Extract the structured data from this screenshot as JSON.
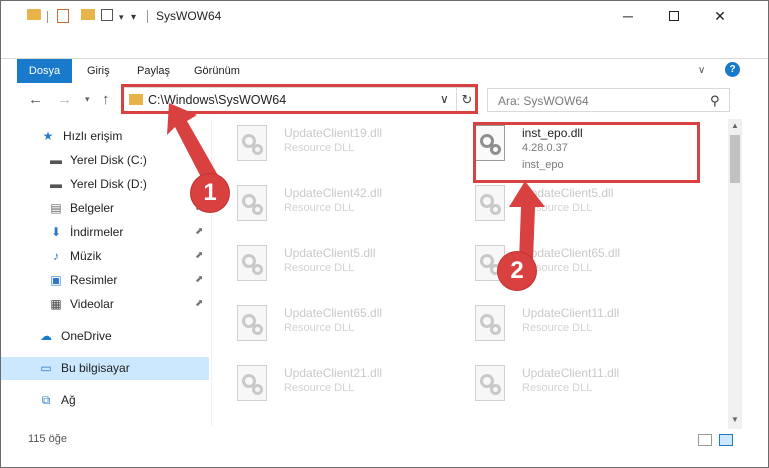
{
  "window": {
    "title": "SysWOW64",
    "minimize_label": "─",
    "close_label": "✕"
  },
  "ribbon": {
    "tabs": [
      "Dosya",
      "Giriş",
      "Paylaş",
      "Görünüm"
    ],
    "help_label": "?"
  },
  "address_bar": {
    "path": "C:\\Windows\\SysWOW64"
  },
  "search": {
    "placeholder": "Ara: SysWOW64"
  },
  "sidebar": {
    "items": [
      {
        "label": "Hızlı erişim",
        "icon": "star-icon"
      },
      {
        "label": "Yerel Disk (C:)",
        "icon": "drive-icon"
      },
      {
        "label": "Yerel Disk (D:)",
        "icon": "drive-icon"
      },
      {
        "label": "Belgeler",
        "icon": "documents-icon",
        "pinned": true
      },
      {
        "label": "İndirmeler",
        "icon": "download-icon",
        "pinned": true
      },
      {
        "label": "Müzik",
        "icon": "music-icon",
        "pinned": true
      },
      {
        "label": "Resimler",
        "icon": "pictures-icon",
        "pinned": true
      },
      {
        "label": "Videolar",
        "icon": "videos-icon",
        "pinned": true
      },
      {
        "label": "OneDrive",
        "icon": "cloud-icon"
      },
      {
        "label": "Bu bilgisayar",
        "icon": "computer-icon",
        "selected": true
      },
      {
        "label": "Ağ",
        "icon": "network-icon"
      }
    ]
  },
  "files": {
    "left": [
      {
        "name": "UpdateClient19.dll",
        "type": "Resource DLL"
      },
      {
        "name": "UpdateClient42.dll",
        "type": "Resource DLL"
      },
      {
        "name": "UpdateClient5.dll",
        "type": "Resource DLL"
      },
      {
        "name": "UpdateClient65.dll",
        "type": "Resource DLL"
      },
      {
        "name": "UpdateClient21.dll",
        "type": "Resource DLL"
      }
    ],
    "right": [
      {
        "name": "inst_epo.dll",
        "version": "4.28.0.37",
        "type": "inst_epo",
        "highlighted": true
      },
      {
        "name": "UpdateClient5.dll",
        "type": "Resource DLL"
      },
      {
        "name": "UpdateClient65.dll",
        "type": "Resource DLL"
      },
      {
        "name": "UpdateClient11.dll",
        "type": "Resource DLL"
      },
      {
        "name": "UpdateClient11.dll",
        "type": "Resource DLL"
      }
    ]
  },
  "status_bar": {
    "item_count": "115 öğe"
  },
  "annotations": {
    "step_1": "1",
    "step_2": "2",
    "color": "#d94141"
  },
  "colors": {
    "accent": "#1979ca",
    "selected_bg": "#cce8ff"
  }
}
